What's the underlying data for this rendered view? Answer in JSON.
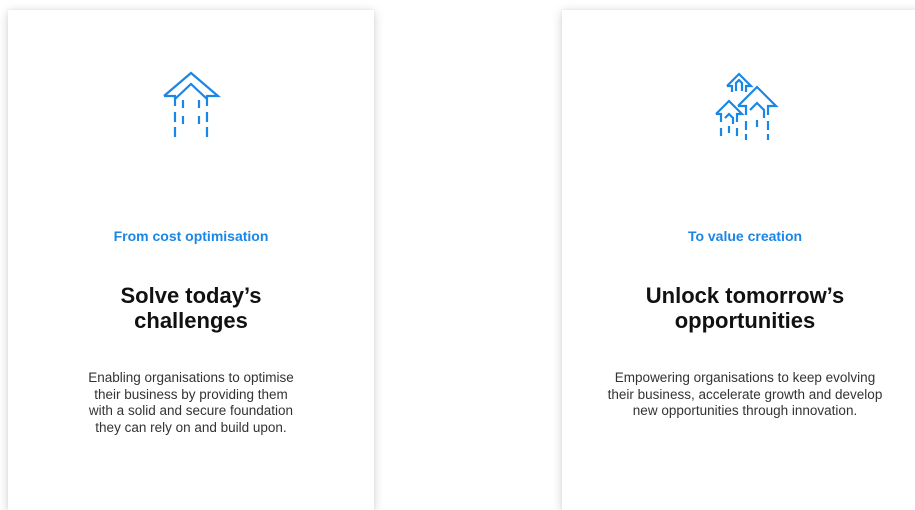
{
  "accent_color": "#1a86e6",
  "cards": [
    {
      "icon": "single-arrow-up-icon",
      "kicker": "From cost optimisation",
      "title_line1": "Solve today’s",
      "title_line2": "challenges",
      "description": "Enabling organisations to optimise their business by providing them with a solid and secure foundation they can rely on and build upon."
    },
    {
      "icon": "multiple-arrows-up-icon",
      "kicker": "To value creation",
      "title_line1": "Unlock tomorrow’s",
      "title_line2": "opportunities",
      "description": "Empowering organisations to keep evolving their business, accelerate growth and develop new opportunities through innovation."
    }
  ]
}
